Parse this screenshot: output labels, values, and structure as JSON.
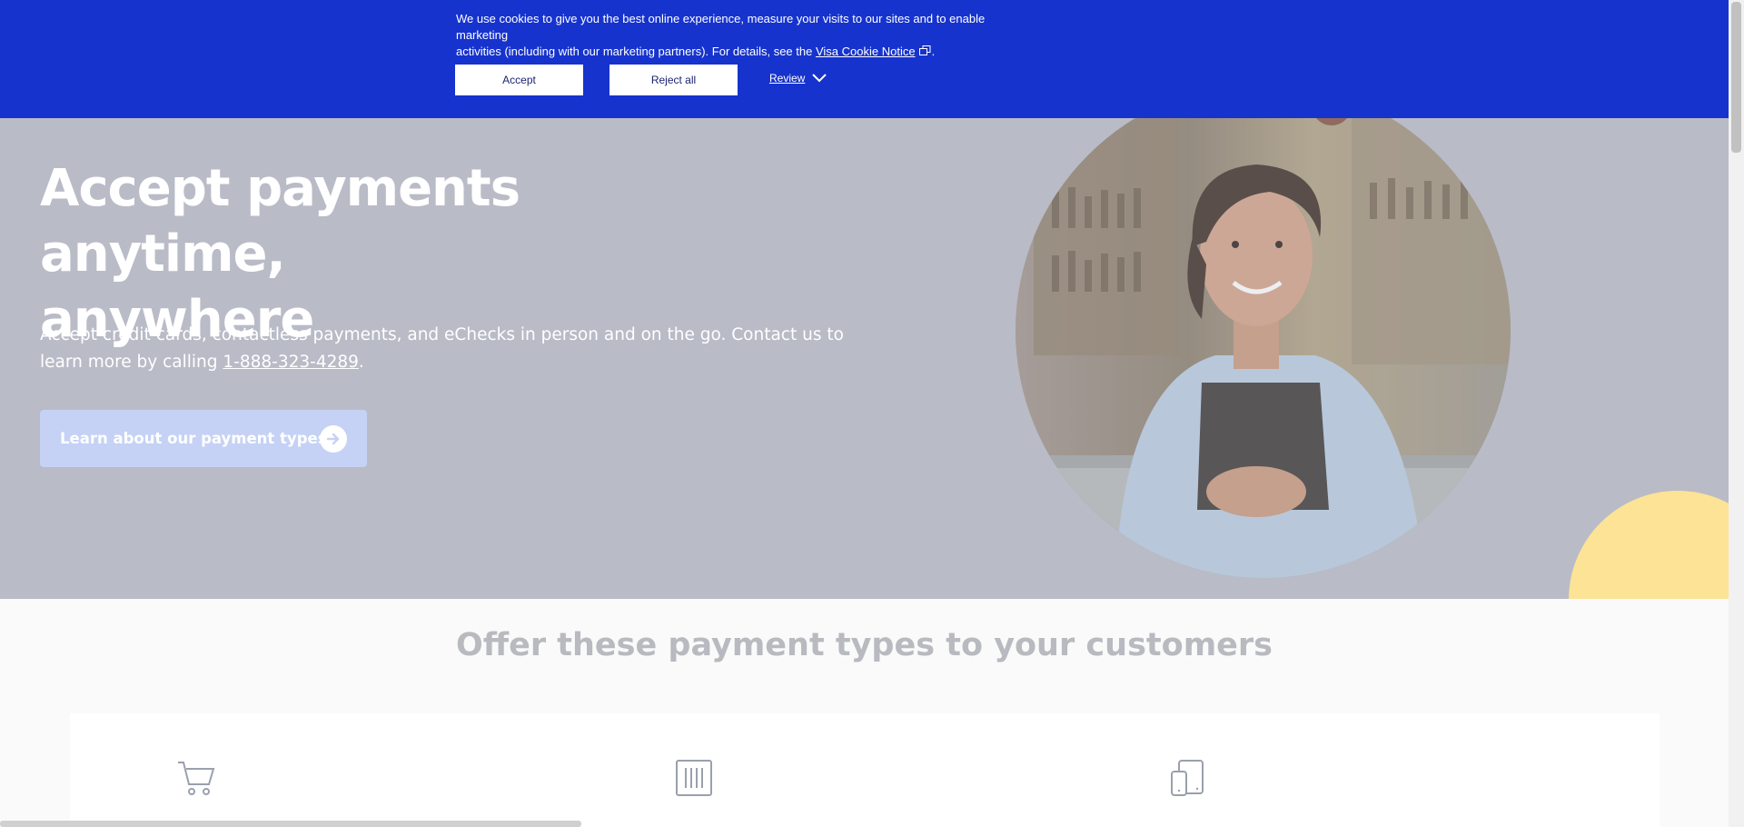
{
  "cookie_banner": {
    "text_line1": "We use cookies to give you the best online experience, measure your visits to our sites and to enable marketing",
    "text_line2": "activities (including with our marketing partners). For details, see the",
    "notice_link": "Visa Cookie Notice",
    "period": ".",
    "accept_label": "Accept",
    "reject_label": "Reject all",
    "review_label": "Review",
    "background_color": "#1633cd"
  },
  "hero": {
    "title_line1": "Accept payments anytime,",
    "title_line2": "anywhere",
    "description_part1": "Accept credit cards, contactless payments, and eChecks in person and on the go. Contact us to learn more by calling",
    "phone": "1-888-323-4289",
    "description_end": ".",
    "cta_label": "Learn about our payment types",
    "cta_icon": "arrow-right-circle-icon",
    "background_color": "#b9bbc7",
    "accent_yellow": "#fce395"
  },
  "payment_section": {
    "title": "Offer these payment types to your customers",
    "icons": [
      "shopping-cart-icon",
      "barcode-terminal-icon",
      "mobile-devices-icon"
    ]
  }
}
